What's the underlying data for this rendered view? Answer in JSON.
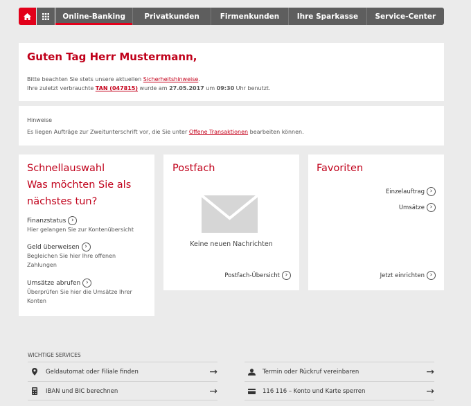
{
  "nav": {
    "tabs": [
      "Online-Banking",
      "Privatkunden",
      "Firmenkunden",
      "Ihre Sparkasse",
      "Service-Center"
    ]
  },
  "greeting": {
    "title": "Guten Tag Herr Mustermann,",
    "line1_pre": "Bitte beachten Sie stets unsere aktuellen ",
    "line1_link": "Sicherheitshinweise",
    "line1_post": ".",
    "line2_pre": "Ihre zuletzt verbrauchte ",
    "line2_link": "TAN (047815)",
    "line2_mid1": " wurde am ",
    "line2_date": "27.05.2017",
    "line2_mid2": " um ",
    "line2_time": "09:30",
    "line2_post": " Uhr benutzt."
  },
  "notice": {
    "heading": "Hinweise",
    "text_pre": "Es liegen Aufträge zur Zweitunterschrift vor, die Sie unter ",
    "text_link": "Offene Transaktionen",
    "text_post": " bearbeiten können."
  },
  "quick": {
    "title1": "Schnellauswahl",
    "title2": "Was möchten Sie als",
    "title3": "nächstes tun?",
    "items": [
      {
        "title": "Finanzstatus",
        "sub": "Hier gelangen Sie zur Kontenübersicht"
      },
      {
        "title": "Geld überweisen",
        "sub": "Begleichen Sie hier Ihre offenen Zahlungen"
      },
      {
        "title": "Umsätze abrufen",
        "sub": "Überprüfen Sie hier die Umsätze Ihrer Konten"
      }
    ]
  },
  "postfach": {
    "title": "Postfach",
    "empty": "Keine neuen Nachrichten",
    "link": "Postfach-Übersicht"
  },
  "favorites": {
    "title": "Favoriten",
    "items": [
      "Einzelauftrag",
      "Umsätze"
    ],
    "link": "Jetzt einrichten"
  },
  "services": {
    "heading": "WICHTIGE SERVICES",
    "left": [
      {
        "icon": "map-pin-icon",
        "label": "Geldautomat oder Filiale finden"
      },
      {
        "icon": "calculator-icon",
        "label": "IBAN und BIC berechnen"
      }
    ],
    "right": [
      {
        "icon": "person-icon",
        "label": "Termin oder Rückruf vereinbaren"
      },
      {
        "icon": "card-icon",
        "label": "116 116 – Konto und Karte sperren"
      }
    ]
  },
  "colors": {
    "accent": "#e2001a",
    "nav": "#5e5e5e",
    "background": "#ebebeb"
  }
}
